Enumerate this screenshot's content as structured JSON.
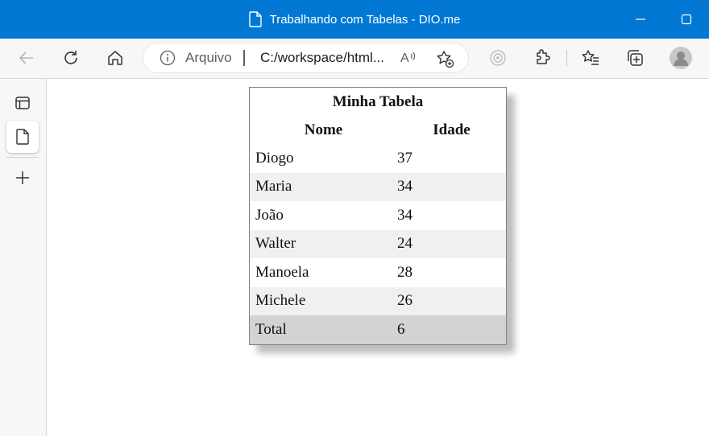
{
  "window": {
    "title": "Trabalhando com Tabelas - DIO.me"
  },
  "toolbar": {
    "icons": [
      "back-icon",
      "refresh-icon",
      "home-icon",
      "info-icon",
      "read-aloud-icon",
      "add-favorite-icon",
      "extension-icon",
      "puzzle-icon",
      "favorites-icon",
      "collections-icon",
      "profile-avatar"
    ]
  },
  "address": {
    "scheme_label": "Arquivo",
    "url": "C:/workspace/html...",
    "read_aloud": "A’⁾"
  },
  "sidebar": {
    "icons": [
      "tab-actions-icon",
      "document-icon",
      "new-tab-plus-icon"
    ]
  },
  "table": {
    "caption": "Minha Tabela",
    "headers": [
      "Nome",
      "Idade"
    ],
    "rows": [
      {
        "name": "Diogo",
        "age": "37"
      },
      {
        "name": "Maria",
        "age": "34"
      },
      {
        "name": "João",
        "age": "34"
      },
      {
        "name": "Walter",
        "age": "24"
      },
      {
        "name": "Manoela",
        "age": "28"
      },
      {
        "name": "Michele",
        "age": "26"
      }
    ],
    "total": {
      "label": "Total",
      "value": "6"
    }
  },
  "colors": {
    "titlebar": "#0078d4",
    "row_alt": "#f0f0f0",
    "row_total": "#d3d3d3"
  }
}
